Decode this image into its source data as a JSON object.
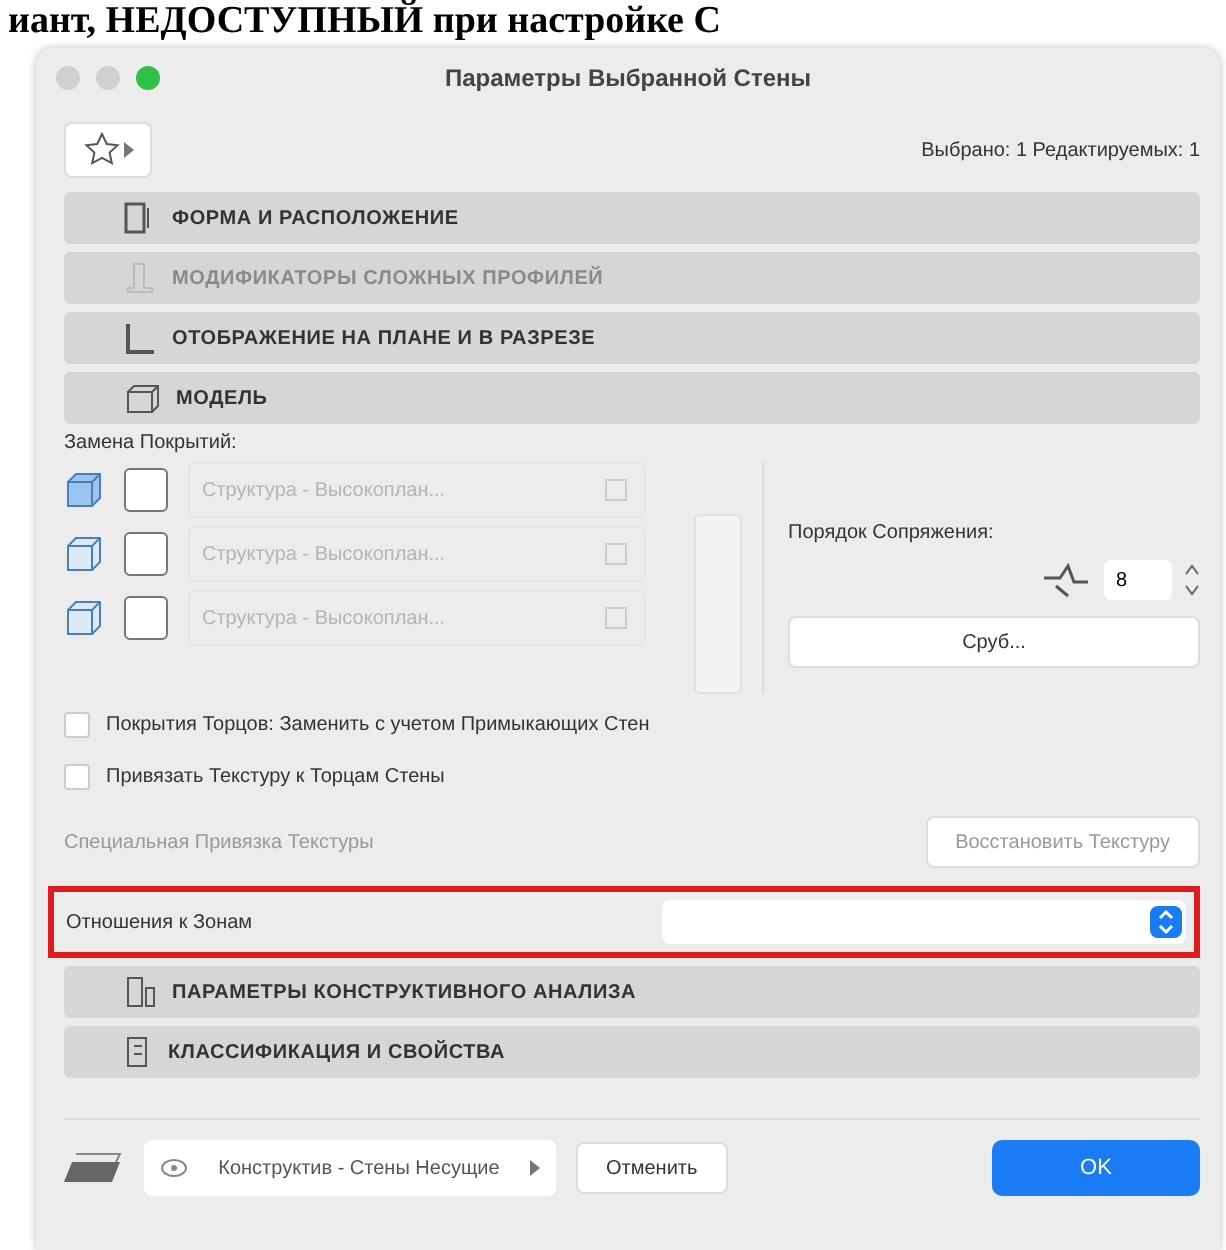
{
  "heading": "иант, НЕДОСТУПНЫЙ при настройке С",
  "window": {
    "title": "Параметры Выбранной Стены"
  },
  "toolbar": {
    "selection_info": "Выбрано: 1 Редактируемых: 1"
  },
  "sections_top": [
    {
      "label": "ФОРМА И РАСПОЛОЖЕНИЕ",
      "disabled": false,
      "kind": "shape"
    },
    {
      "label": "МОДИФИКАТОРЫ СЛОЖНЫХ ПРОФИЛЕЙ",
      "disabled": true,
      "kind": "profile"
    },
    {
      "label": "ОТОБРАЖЕНИЕ НА ПЛАНЕ И В РАЗРЕЗЕ",
      "disabled": false,
      "kind": "plan"
    },
    {
      "label": "МОДЕЛЬ",
      "disabled": false,
      "kind": "model"
    }
  ],
  "model": {
    "override_label": "Замена Покрытий:",
    "overrides": [
      {
        "value": "Структура - Высокоплан...",
        "checked": false
      },
      {
        "value": "Структура - Высокоплан...",
        "checked": false
      },
      {
        "value": "Структура - Высокоплан...",
        "checked": false
      }
    ],
    "intersection_label": "Порядок Сопряжения:",
    "intersection_value": "8",
    "log_button": "Сруб...",
    "options": [
      {
        "label": "Покрытия Торцов: Заменить с учетом Примыкающих Стен",
        "checked": false
      },
      {
        "label": "Привязать Текстуру к Торцам Стены",
        "checked": false
      }
    ],
    "texture_label": "Специальная Привязка Текстуры",
    "texture_button": "Восстановить Текстуру",
    "zones_label": "Отношения к Зонам",
    "zones_highlighted": true
  },
  "sections_bottom": [
    {
      "label": "ПАРАМЕТРЫ КОНСТРУКТИВНОГО АНАЛИЗА",
      "disabled": false,
      "kind": "analysis"
    },
    {
      "label": "КЛАССИФИКАЦИЯ И СВОЙСТВА",
      "disabled": false,
      "kind": "classification"
    }
  ],
  "footer": {
    "layer": "Конструктив - Стены Несущие",
    "cancel": "Отменить",
    "ok": "OK"
  }
}
